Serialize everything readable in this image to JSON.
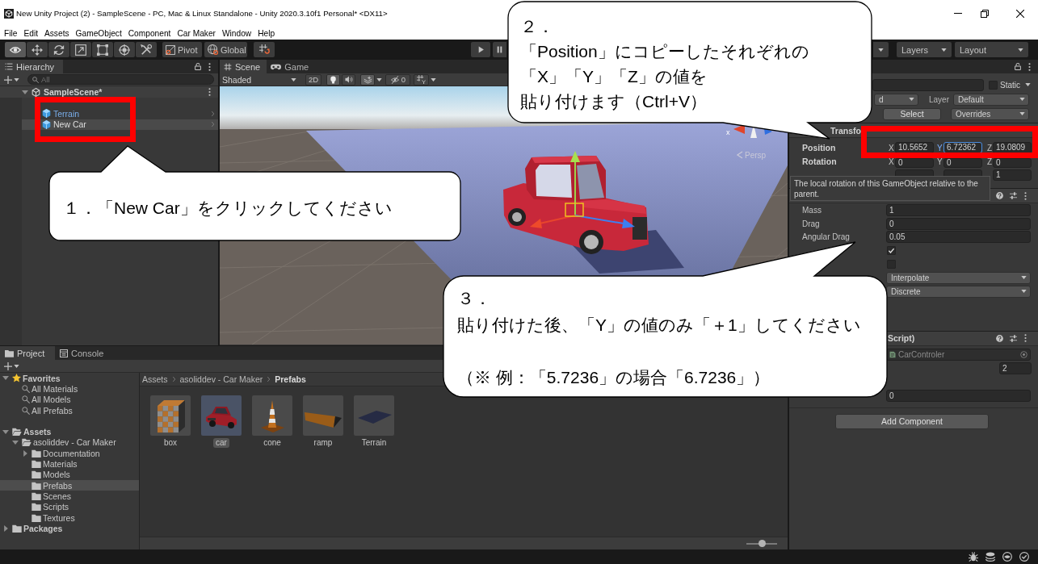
{
  "window": {
    "title": "New Unity Project (2) - SampleScene - PC, Mac & Linux Standalone - Unity 2020.3.10f1 Personal* <DX11>"
  },
  "menu": [
    "File",
    "Edit",
    "Assets",
    "GameObject",
    "Component",
    "Car Maker",
    "Window",
    "Help"
  ],
  "toolbar": {
    "tools": [
      {
        "kind": "view",
        "selected": true
      },
      {
        "kind": "move",
        "selected": false
      },
      {
        "kind": "rotate",
        "selected": false
      },
      {
        "kind": "scale",
        "selected": false
      },
      {
        "kind": "rect",
        "selected": false
      },
      {
        "kind": "transform",
        "selected": false
      },
      {
        "kind": "custom",
        "selected": false
      }
    ],
    "pivot": "Pivot",
    "space": "Global",
    "layers": "Layers",
    "layout": "Layout"
  },
  "hierarchy": {
    "title": "Hierarchy",
    "search_placeholder": "All",
    "scene": {
      "label": "SampleScene*",
      "expanded": true
    },
    "items": [
      {
        "label": "Terrain",
        "selected": false
      },
      {
        "label": "New Car",
        "selected": true
      }
    ]
  },
  "scene_view": {
    "tabs": [
      {
        "label": "Scene",
        "kind": "scene",
        "selected": true
      },
      {
        "label": "Game",
        "kind": "game",
        "selected": false
      }
    ],
    "shading": "Shaded",
    "toggles": [
      {
        "kind": "mode",
        "label": "2D",
        "on": false
      },
      {
        "kind": "lighting",
        "on": true
      },
      {
        "kind": "audio",
        "on": false
      },
      {
        "kind": "effects",
        "on": true
      }
    ],
    "hidden_count": "0",
    "axis_label": "x",
    "projection": "Persp"
  },
  "inspector": {
    "static": {
      "label": "Static",
      "checked": false
    },
    "tag": "d",
    "layer_label": "Layer",
    "layer": "Default",
    "prefab": {
      "select": "Select",
      "overrides": "Overrides"
    },
    "transform": {
      "title": "Transfo",
      "rows": [
        {
          "label": "Position",
          "fields": [
            {
              "axis": "X",
              "value": "10.5652",
              "focused": false
            },
            {
              "axis": "Y",
              "value": "6.72362",
              "focused": true
            },
            {
              "axis": "Z",
              "value": "19.0809",
              "focused": false
            }
          ]
        },
        {
          "label": "Rotation",
          "fields": [
            {
              "axis": "X",
              "value": "0",
              "focused": false
            },
            {
              "axis": "Y",
              "value": "0",
              "focused": false
            },
            {
              "axis": "Z",
              "value": "0",
              "focused": false
            }
          ]
        }
      ],
      "scale_z": "1"
    },
    "tooltip": "The local rotation of this GameObject relative to the parent.",
    "rigidbody": [
      {
        "kind": "number",
        "label": "Mass",
        "value": "1"
      },
      {
        "kind": "number",
        "label": "Drag",
        "value": "0"
      },
      {
        "kind": "number",
        "label": "Angular Drag",
        "value": "0.05"
      },
      {
        "kind": "checkbox",
        "checked": true
      },
      {
        "kind": "checkbox",
        "checked": false
      },
      {
        "kind": "dropdown",
        "value": "Interpolate"
      },
      {
        "kind": "dropdown",
        "value": "Discrete"
      }
    ],
    "script_component": {
      "title": "Script)",
      "script": "CarControler",
      "rows": [
        {
          "kind": "small",
          "value": "2"
        },
        {
          "kind": "wide",
          "value": "0"
        }
      ]
    },
    "add_component": "Add Component"
  },
  "project": {
    "tabs": [
      {
        "label": "Project",
        "kind": "project",
        "selected": true
      },
      {
        "label": "Console",
        "kind": "console",
        "selected": false
      }
    ],
    "tree": [
      {
        "label": "Favorites",
        "kind": "favorites",
        "expanded": true,
        "selected": false,
        "children": [
          {
            "label": "All Materials",
            "kind": "search",
            "selected": false
          },
          {
            "label": "All Models",
            "kind": "search",
            "selected": false
          },
          {
            "label": "All Prefabs",
            "kind": "search",
            "selected": false
          }
        ]
      },
      {
        "label": "Assets",
        "kind": "folder",
        "expanded": true,
        "selected": false,
        "children": [
          {
            "label": "asoliddev - Car Maker",
            "kind": "folder",
            "expanded": true,
            "selected": false,
            "children": [
              {
                "label": "Documentation",
                "kind": "folder",
                "expanded": false,
                "selected": false
              },
              {
                "label": "Materials",
                "kind": "folder",
                "selected": false
              },
              {
                "label": "Models",
                "kind": "folder",
                "selected": false
              },
              {
                "label": "Prefabs",
                "kind": "folder",
                "selected": true
              },
              {
                "label": "Scenes",
                "kind": "folder",
                "selected": false
              },
              {
                "label": "Scripts",
                "kind": "folder",
                "selected": false
              },
              {
                "label": "Textures",
                "kind": "folder",
                "selected": false
              }
            ]
          }
        ]
      },
      {
        "label": "Packages",
        "kind": "folder",
        "expanded": false,
        "selected": false
      }
    ],
    "breadcrumb": [
      {
        "label": "Assets",
        "current": false
      },
      {
        "label": "asoliddev - Car Maker",
        "current": false
      },
      {
        "label": "Prefabs",
        "current": true
      }
    ],
    "assets": [
      {
        "label": "box",
        "kind": "box",
        "selected": false
      },
      {
        "label": "car",
        "kind": "car",
        "selected": true
      },
      {
        "label": "cone",
        "kind": "cone",
        "selected": false
      },
      {
        "label": "ramp",
        "kind": "ramp",
        "selected": false
      },
      {
        "label": "Terrain",
        "kind": "terrain",
        "selected": false
      }
    ],
    "icon_size_slider": {
      "level": 0.5
    }
  },
  "callouts": [
    {
      "paragraphs": [
        [
          "１．「New Car」をクリックしてください"
        ]
      ]
    },
    {
      "paragraphs": [
        [
          "２．",
          "「Position」にコピーしたそれぞれの",
          "「X」「Y」「Z」の値を",
          "貼り付けます（Ctrl+V）"
        ]
      ]
    },
    {
      "paragraphs": [
        [
          "３．",
          "貼り付けた後、「Y」の値のみ「＋1」してください"
        ],
        [
          "（※ 例：「5.7236」の場合「6.7236」）"
        ]
      ]
    }
  ]
}
